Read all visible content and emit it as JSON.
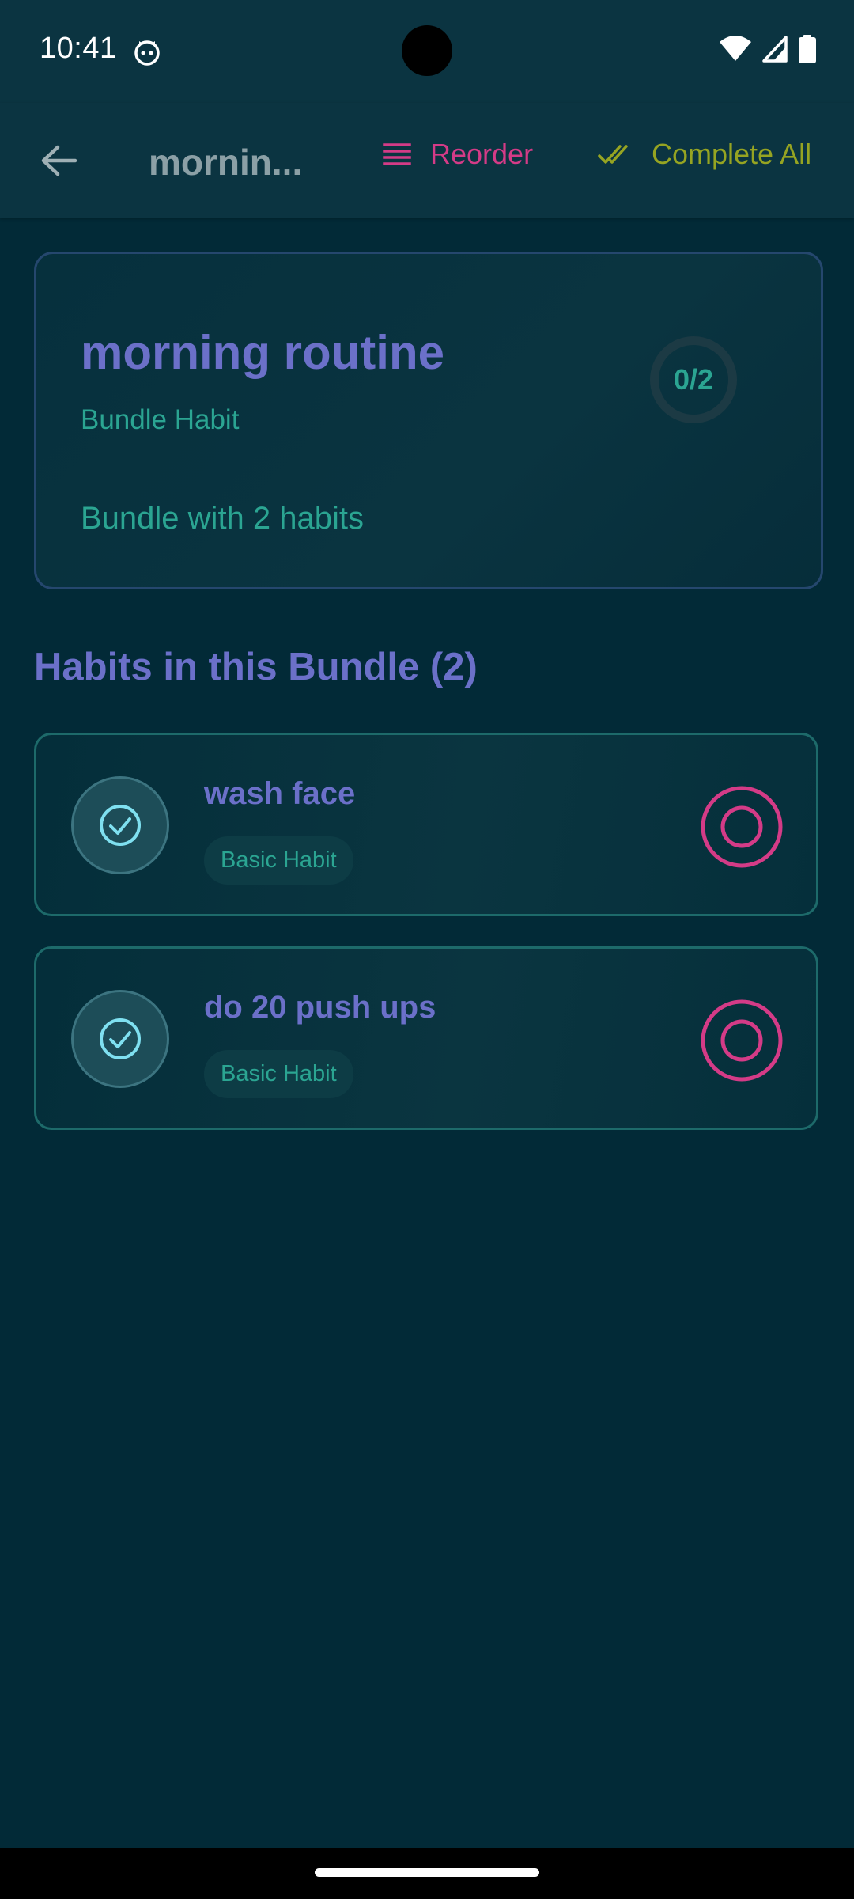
{
  "status_bar": {
    "time": "10:41",
    "icons": [
      "cat-notification-icon",
      "wifi-icon",
      "signal-icon",
      "battery-icon"
    ]
  },
  "app_bar": {
    "title": "mornin...",
    "reorder_label": "Reorder",
    "complete_all_label": "Complete All",
    "icons": [
      "back-arrow-icon",
      "reorder-lines-icon",
      "double-check-icon"
    ]
  },
  "bundle": {
    "title": "morning routine",
    "type": "Bundle Habit",
    "description": "Bundle with 2 habits",
    "progress": "0/2",
    "progress_fraction": 0
  },
  "section": {
    "title": "Habits in this Bundle (2)"
  },
  "habits": [
    {
      "name": "wash face",
      "badge": "Basic Habit",
      "icons": [
        "check-circle-icon",
        "target-icon"
      ]
    },
    {
      "name": "do 20 push ups",
      "badge": "Basic Habit",
      "icons": [
        "check-circle-icon",
        "target-icon"
      ]
    }
  ],
  "colors": {
    "background": "#022a37",
    "app_bar": "#0b3441",
    "primary_text": "#6b70c9",
    "secondary_text": "#2ba592",
    "reorder": "#d43b87",
    "complete_all": "#96a422",
    "target": "#d43b87"
  }
}
